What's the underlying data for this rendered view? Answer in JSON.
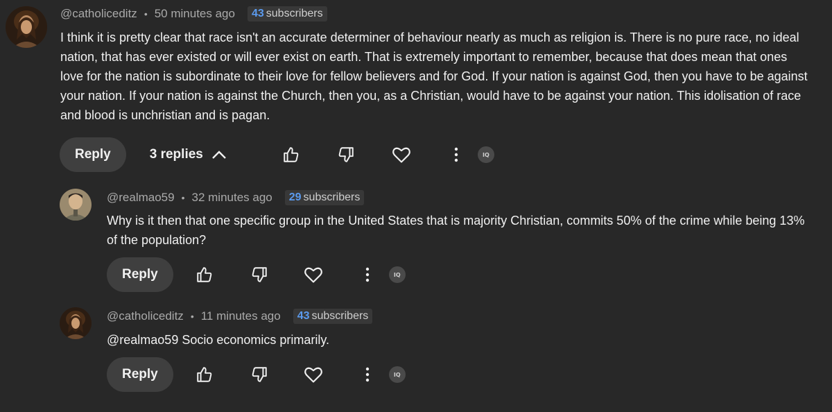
{
  "comments": [
    {
      "handle": "@catholiceditz",
      "time": "50 minutes ago",
      "subscriber_count": "43",
      "subscriber_label": "subscribers",
      "lines": [
        "I think it is pretty clear that race isn't an accurate determiner of behaviour nearly as much as religion is. There is no pure race, no ideal",
        "nation, that has ever existed or will ever exist on earth. That is extremely important to remember, because that does mean that ones",
        "love for the nation is subordinate to their love for fellow believers and for God. If your nation is against God, then you have to be against",
        "your nation. If your nation is against the Church, then you, as a Christian, would have to be against your nation. This idolisation of race",
        "and blood is unchristian and is pagan."
      ],
      "reply_label": "Reply",
      "replies_label": "3 replies",
      "avatar_icon": "jesus-portrait-avatar"
    },
    {
      "handle": "@realmao59",
      "time": "32 minutes ago",
      "subscriber_count": "29",
      "subscriber_label": "subscribers",
      "lines": [
        "Why is it then that one specific group in the United States that is majority Christian, commits 50% of the crime while being 13%",
        "of the population?"
      ],
      "reply_label": "Reply",
      "avatar_icon": "mao-portrait-avatar"
    },
    {
      "handle": "@catholiceditz",
      "time": "11 minutes ago",
      "subscriber_count": "43",
      "subscriber_label": "subscribers",
      "lines": [
        "@realmao59 Socio economics primarily."
      ],
      "reply_label": "Reply",
      "avatar_icon": "jesus-portrait-avatar"
    }
  ],
  "iq_badge_label": "IQ",
  "colors": {
    "background": "#282828",
    "text": "#f1f1f1",
    "muted": "#aaaaaa",
    "subscriber_number": "#5b9bef",
    "button_bg": "#3f3f3f"
  }
}
